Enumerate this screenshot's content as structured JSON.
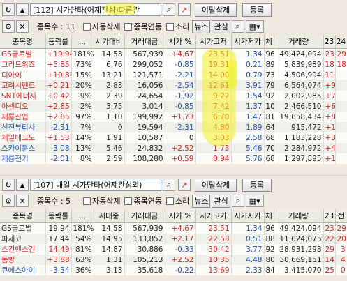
{
  "top": {
    "toolbar": {
      "code_text": "[112] 시가단타(어제관심)다른관",
      "delete_label": "이탈삭제",
      "register_label": "등록"
    },
    "options": {
      "count_label": "종목수 : 11",
      "auto_delete_label": "자동삭제",
      "stock_link_label": "종목연동",
      "sound_label": "소리",
      "news_label": "뉴스",
      "watch_label": "관심"
    },
    "columns": [
      "종목명",
      "등락률",
      "...",
      "시가대비",
      "거래대금",
      "시가 %",
      "시가고저",
      "시가저가",
      "체",
      "거래량",
      "23",
      "24"
    ],
    "rows": [
      {
        "name": "GS글로벌",
        "rate": "+19.94",
        "pct": "181%",
        "open": "14.58",
        "amount": "567,939",
        "open_pct": "+4.67",
        "high": "23.51",
        "low": "1.34",
        "str": "96",
        "volume": "49,424,094",
        "c1": "23",
        "c2": "29",
        "tone": "up"
      },
      {
        "name": "그리드위즈",
        "rate": "+5.85",
        "pct": "73%",
        "open": "6.76",
        "amount": "299,052",
        "open_pct": "-0.85",
        "high": "19.31",
        "low": "0.21",
        "str": "89",
        "volume": "5,839,989",
        "c1": "18",
        "c2": "18",
        "tone": "up"
      },
      {
        "name": "디아이",
        "rate": "+10.81",
        "pct": "15%",
        "open": "13.21",
        "amount": "121,571",
        "open_pct": "-2.21",
        "high": "14.00",
        "low": "0.79",
        "str": "73",
        "volume": "4,506,994",
        "c1": "11",
        "c2": "",
        "tone": "up"
      },
      {
        "name": "고려시멘트",
        "rate": "+0.21",
        "pct": "20%",
        "open": "2.83",
        "amount": "16,056",
        "open_pct": "-2.54",
        "high": "12.61",
        "low": "3.91",
        "str": "79",
        "volume": "6,564,074",
        "c1": "+9",
        "c2": "",
        "tone": "up"
      },
      {
        "name": "SNT에너지",
        "rate": "+0.42",
        "pct": "9%",
        "open": "2.39",
        "amount": "24,654",
        "open_pct": "-1.92",
        "high": "9.22",
        "low": "1.54",
        "str": "92",
        "volume": "2,002,985",
        "c1": "+7",
        "c2": "",
        "tone": "up"
      },
      {
        "name": "아센디오",
        "rate": "+2.85",
        "pct": "2%",
        "open": "3.75",
        "amount": "3,014",
        "open_pct": "-0.85",
        "high": "7.42",
        "low": "1.37",
        "str": "10",
        "volume": "2,466,510",
        "c1": "+6",
        "c2": "",
        "tone": "up"
      },
      {
        "name": "제룡산업",
        "rate": "+2.85",
        "pct": "97%",
        "open": "1.10",
        "amount": "199,992",
        "open_pct": "+1.73",
        "high": "6.70",
        "low": "1.47",
        "str": "81",
        "volume": "19,658,434",
        "c1": "+8",
        "c2": "",
        "tone": "up"
      },
      {
        "name": "선진뷰티사",
        "rate": "-2.31",
        "pct": "7%",
        "open": "0",
        "amount": "19,594",
        "open_pct": "-2.31",
        "high": "4.80",
        "low": "1.89",
        "str": "64",
        "volume": "915,472",
        "c1": "+1",
        "c2": "",
        "tone": "dn"
      },
      {
        "name": "제일테크노",
        "rate": "+1.53",
        "pct": "14%",
        "open": "1.91",
        "amount": "10,587",
        "open_pct": "0",
        "high": "3.03",
        "low": "2.58",
        "str": "68",
        "volume": "1,183,228",
        "c1": "+3",
        "c2": "",
        "tone": "up"
      },
      {
        "name": "스카이문스",
        "rate": "-3.08",
        "pct": "13%",
        "open": "5.46",
        "amount": "24,832",
        "open_pct": "+2.52",
        "high": "1.73",
        "low": "5.46",
        "str": "70",
        "volume": "2,284,972",
        "c1": "+4",
        "c2": "",
        "tone": "dn"
      },
      {
        "name": "제룡전기",
        "rate": "-2.01",
        "pct": "8%",
        "open": "2.59",
        "amount": "108,280",
        "open_pct": "+0.59",
        "high": "0.94",
        "low": "5.76",
        "str": "68",
        "volume": "1,297,895",
        "c1": "+1",
        "c2": "",
        "tone": "dn"
      }
    ]
  },
  "bottom": {
    "toolbar": {
      "code_text": "[107] 내일 시가단타(어제관심외)",
      "delete_label": "이탈삭제",
      "register_label": "등록"
    },
    "options": {
      "count_label": "종목수 : 5",
      "auto_delete_label": "자동삭제",
      "stock_link_label": "종목연동",
      "sound_label": "소리",
      "news_label": "뉴스",
      "watch_label": "관심"
    },
    "columns": [
      "종목명",
      "등락률",
      "...",
      "시대중",
      "거래대금",
      "시가 %",
      "시가고가",
      "시가저가",
      "체",
      "거래량",
      "23",
      "전"
    ],
    "rows": [
      {
        "name": "GS글로벌",
        "rate": "19.94",
        "pct": "181%",
        "open": "14.58",
        "amount": "567,939",
        "open_pct": "+4.67",
        "high": "23.51",
        "low": "1.34",
        "str": "96",
        "volume": "49,424,094",
        "c1": "23",
        "c2": "29",
        "tone": "blk"
      },
      {
        "name": "파세코",
        "rate": "17.44",
        "pct": "54%",
        "open": "14.95",
        "amount": "133,852",
        "open_pct": "+2.17",
        "high": "22.53",
        "low": "0.51",
        "str": "88",
        "volume": "11,624,075",
        "c1": "22",
        "c2": "20",
        "tone": "blk"
      },
      {
        "name": "스킨앤스킨",
        "rate": "14.49",
        "pct": "81%",
        "open": "14.87",
        "amount": "30,886",
        "open_pct": "-0.33",
        "high": "30.42",
        "low": "3.77",
        "str": "92",
        "volume": "28,931,298",
        "c1": "29",
        "c2": "3",
        "tone": "up"
      },
      {
        "name": "동방",
        "rate": "+3.88",
        "pct": "63%",
        "open": "1.31",
        "amount": "105,213",
        "open_pct": "+2.52",
        "high": "10.35",
        "low": "4.48",
        "str": "80",
        "volume": "30,669,151",
        "c1": "14",
        "c2": "4",
        "tone": "up"
      },
      {
        "name": "큐에스아이",
        "rate": "-3.34",
        "pct": "36%",
        "open": "3.13",
        "amount": "35,618",
        "open_pct": "-0.22",
        "high": "13.69",
        "low": "2.33",
        "str": "84",
        "volume": "3,415,070",
        "c1": "25",
        "c2": "0",
        "tone": "dn"
      }
    ]
  },
  "icons": {
    "refresh": "refresh-icon",
    "search": "search-icon",
    "chart": "chart-icon",
    "settings": "gear-icon",
    "close": "close-icon",
    "grid": "grid-icon",
    "scroll_up": "up-arrow-icon"
  }
}
